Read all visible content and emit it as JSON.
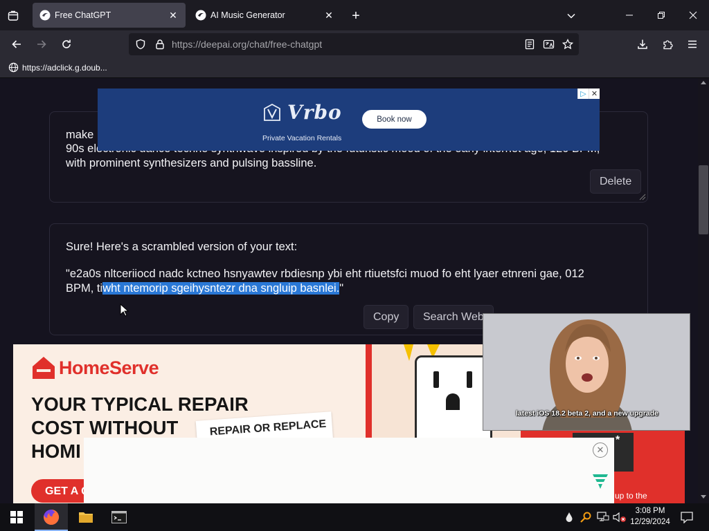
{
  "browser": {
    "tabs": [
      {
        "title": "Free ChatGPT",
        "active": true
      },
      {
        "title": "AI Music Generator",
        "active": false
      }
    ],
    "url_host": "https://deepai.org",
    "url_path": "/chat/free-chatgpt",
    "bookmark": "https://adclick.g.doub..."
  },
  "chat": {
    "user_message": {
      "line1": "make",
      "line2": "90s electronic dance techno synthwave inspired by the futuristic mood of the early internet age, 120 BPM,",
      "line3": "with prominent synthesizers and pulsing bassline.",
      "delete_label": "Delete"
    },
    "ai_message": {
      "intro": "Sure! Here's a scrambled version of your text:",
      "line1": "\"e2a0s nltceriiocd nadc kctneo hsnyawtev rbdiesnp ybi eht rtiuetsfci muod fo eht lyaer etnreni gae, 012",
      "line2_pre": "BPM, ti",
      "line2_selected": "wht ntemorip sgeihysntezr dna sngluip basnlei.",
      "line2_post": "\"",
      "copy_label": "Copy",
      "search_label": "Search Web"
    }
  },
  "ads": {
    "vrbo": {
      "brand": "Vrbo",
      "tagline": "Private Vacation Rentals",
      "cta": "Book now"
    },
    "homeserve": {
      "brand": "HomeServe",
      "headline_1": "YOUR TYPICAL REPAIR",
      "headline_2": "COST WITHOUT",
      "headline_3": "HOMI",
      "banner": "REPAIR OR REPLACE",
      "cta": "GET A Q",
      "fine_print": "irs up to the"
    },
    "video": {
      "caption": "latest iOS 18.2 beta 2, and a new upgrade"
    }
  },
  "taskbar": {
    "time": "3:08 PM",
    "date": "12/29/2024"
  },
  "colors": {
    "selection": "#2a78d6",
    "page_bg": "#15131f",
    "vrbo_blue": "#1d3d7c",
    "homeserve_red": "#e0302b"
  }
}
